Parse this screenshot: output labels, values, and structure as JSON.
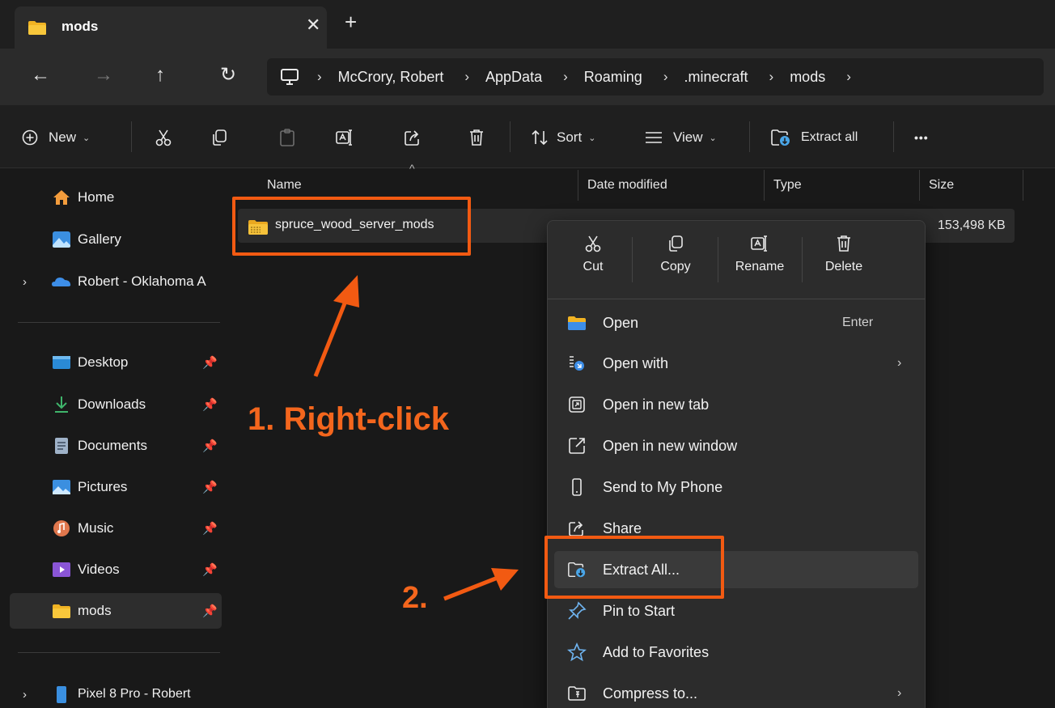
{
  "tab": {
    "title": "mods",
    "close": "✕",
    "new_tab": "+"
  },
  "nav": {
    "back": "←",
    "forward": "→",
    "up": "↑",
    "refresh": "↻",
    "sep": "›",
    "breadcrumbs": [
      "McCrory, Robert",
      "AppData",
      "Roaming",
      ".minecraft",
      "mods"
    ]
  },
  "toolbar": {
    "new_label": "New",
    "sort_label": "Sort",
    "view_label": "View",
    "extract_all_label": "Extract all",
    "more": "•••",
    "chevron": "⌄"
  },
  "sidebar": {
    "expander": "›",
    "pin": "📌",
    "items": [
      {
        "label": "Home",
        "icon": "home-icon"
      },
      {
        "label": "Gallery",
        "icon": "gallery-icon"
      },
      {
        "label": "Robert - Oklahoma A",
        "icon": "onedrive-icon"
      },
      {
        "label": "Desktop",
        "icon": "desktop-icon"
      },
      {
        "label": "Downloads",
        "icon": "download-icon"
      },
      {
        "label": "Documents",
        "icon": "documents-icon"
      },
      {
        "label": "Pictures",
        "icon": "pictures-icon"
      },
      {
        "label": "Music",
        "icon": "music-icon"
      },
      {
        "label": "Videos",
        "icon": "videos-icon"
      },
      {
        "label": "mods",
        "icon": "folder-icon"
      },
      {
        "label": "Pixel 8 Pro - Robert",
        "icon": "phone-icon"
      }
    ]
  },
  "columns": {
    "name": "Name",
    "date": "Date modified",
    "type": "Type",
    "size": "Size",
    "sort_caret": "^"
  },
  "file": {
    "name": "spruce_wood_server_mods",
    "size": "153,498 KB"
  },
  "context_menu": {
    "quick_actions": [
      "Cut",
      "Copy",
      "Rename",
      "Delete"
    ],
    "items": [
      {
        "label": "Open",
        "shortcut": "Enter",
        "icon": "folder-open-icon"
      },
      {
        "label": "Open with",
        "arrow": "›",
        "icon": "open-with-icon"
      },
      {
        "label": "Open in new tab",
        "icon": "new-tab-icon"
      },
      {
        "label": "Open in new window",
        "icon": "new-window-icon"
      },
      {
        "label": "Send to My Phone",
        "icon": "phone-icon"
      },
      {
        "label": "Share",
        "icon": "share-icon"
      },
      {
        "label": "Extract All...",
        "icon": "extract-icon"
      },
      {
        "label": "Pin to Start",
        "icon": "pin-icon"
      },
      {
        "label": "Add to Favorites",
        "icon": "star-icon"
      },
      {
        "label": "Compress to...",
        "arrow": "›",
        "icon": "compress-icon"
      }
    ]
  },
  "annotations": {
    "step1": "1. Right-click",
    "step2": "2."
  },
  "colors": {
    "accent_orange": "#f25a12",
    "background": "#191919",
    "menu_bg": "#2c2c2c"
  }
}
